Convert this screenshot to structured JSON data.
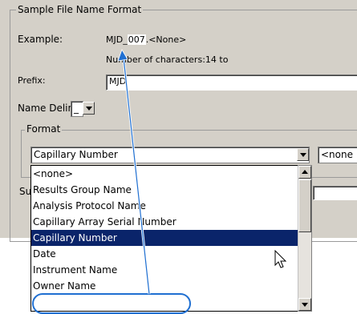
{
  "group": {
    "title": "Sample File Name Format"
  },
  "example": {
    "label": "Example:",
    "prefix_text": "MJD",
    "separator": "_",
    "highlighted": "007",
    "suffix_text": ".<None>",
    "char_count": "Number of characters:14 to"
  },
  "prefix": {
    "label": "Prefix:",
    "value": "MJD"
  },
  "delimiter": {
    "label": "Name Delimiter",
    "value": "_"
  },
  "format": {
    "title": "Format",
    "selected_value": "Capillary Number",
    "next_value": "<none"
  },
  "hidden_label_fragment": "Su",
  "dropdown": {
    "items": [
      "<none>",
      "Results Group Name",
      "Analysis Protocol Name",
      "Capillary Array Serial Number",
      "Capillary Number",
      "Date",
      "Instrument Name",
      "Owner Name"
    ],
    "selected_index": 4
  },
  "icons": {
    "combo_arrow": "chevron-down-icon",
    "pointer": "mouse-pointer-icon",
    "callout": "callout-arrow-icon"
  },
  "colors": {
    "panel_bg": "#d4d0c8",
    "selection_bg": "#0a246a",
    "annotation": "#1f6fd1"
  }
}
